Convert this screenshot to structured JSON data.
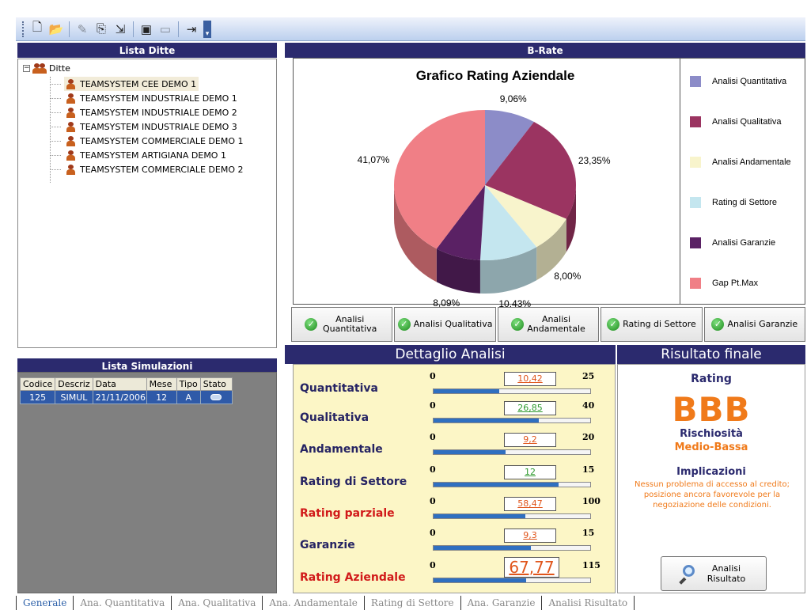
{
  "toolbar": {
    "buttons": [
      "new-icon",
      "open-icon",
      "edit-icon",
      "copy-icon",
      "import-icon",
      "monitor-icon",
      "card-icon",
      "exit-icon"
    ]
  },
  "left": {
    "companies_title": "Lista Ditte",
    "tree_root": "Ditte",
    "companies": [
      "TEAMSYSTEM CEE DEMO 1",
      "TEAMSYSTEM INDUSTRIALE DEMO 1",
      "TEAMSYSTEM INDUSTRIALE DEMO 2",
      "TEAMSYSTEM INDUSTRIALE DEMO 3",
      "TEAMSYSTEM COMMERCIALE DEMO 1",
      "TEAMSYSTEM ARTIGIANA DEMO 1",
      "TEAMSYSTEM COMMERCIALE DEMO 2"
    ],
    "selected_index": 0,
    "sims_title": "Lista Simulazioni",
    "sims_columns": [
      "Codice",
      "Descriz",
      "Data",
      "Mese",
      "Tipo",
      "Stato"
    ],
    "sims_rows": [
      [
        "125",
        "SIMUL",
        "21/11/2006",
        "12",
        "A",
        ""
      ]
    ]
  },
  "chart_panel": {
    "title": "B-Rate"
  },
  "chart_data": {
    "type": "pie",
    "title": "Grafico Rating Aziendale",
    "slices": [
      {
        "name": "Analisi Quantitativa",
        "value": 9.06,
        "label": "9,06%",
        "color": "#8c8cc8"
      },
      {
        "name": "Analisi Qualitativa",
        "value": 23.35,
        "label": "23,35%",
        "color": "#9b3461"
      },
      {
        "name": "Analisi Andamentale",
        "value": 8.0,
        "label": "8,00%",
        "color": "#f8f4cc"
      },
      {
        "name": "Rating di Settore",
        "value": 10.43,
        "label": "10,43%",
        "color": "#c4e6ef"
      },
      {
        "name": "Analisi Garanzie",
        "value": 8.09,
        "label": "8,09%",
        "color": "#5a2164"
      },
      {
        "name": "Gap Pt.Max",
        "value": 41.07,
        "label": "41,07%",
        "color": "#f07f86"
      }
    ],
    "legend_position": "right"
  },
  "analysis_tabs": [
    "Analisi Quantitativa",
    "Analisi Qualitativa",
    "Analisi Andamentale",
    "Rating di Settore",
    "Analisi Garanzie"
  ],
  "detail": {
    "title": "Dettaglio Analisi",
    "rows": [
      {
        "label": "Quantitativa",
        "min": "0",
        "max": "25",
        "value": "10,42",
        "fraction": 0.417,
        "value_color": "#e0551b",
        "label_color": "blue"
      },
      {
        "label": "Qualitativa",
        "min": "0",
        "max": "40",
        "value": "26,85",
        "fraction": 0.671,
        "value_color": "#2e9a2e",
        "label_color": "blue"
      },
      {
        "label": "Andamentale",
        "min": "0",
        "max": "20",
        "value": "9,2",
        "fraction": 0.46,
        "value_color": "#e0551b",
        "label_color": "blue"
      },
      {
        "label": "Rating di Settore",
        "min": "0",
        "max": "15",
        "value": "12",
        "fraction": 0.8,
        "value_color": "#2e9a2e",
        "label_color": "blue"
      },
      {
        "label": "Rating parziale",
        "min": "0",
        "max": "100",
        "value": "58,47",
        "fraction": 0.585,
        "value_color": "#e0551b",
        "label_color": "red"
      },
      {
        "label": "Garanzie",
        "min": "0",
        "max": "15",
        "value": "9,3",
        "fraction": 0.62,
        "value_color": "#e0551b",
        "label_color": "blue"
      },
      {
        "label": "Rating Aziendale",
        "min": "0",
        "max": "115",
        "value": "67,77",
        "fraction": 0.589,
        "value_color": "#e0551b",
        "label_color": "red"
      }
    ]
  },
  "result": {
    "title": "Risultato finale",
    "rating_label": "Rating",
    "rating_value": "BBB",
    "risk_label": "Rischiosità",
    "risk_value": "Medio-Bassa",
    "impl_label": "Implicazioni",
    "impl_text": "Nessun problema di accesso al credito; posizione ancora favorevole per la negoziazione delle condizioni.",
    "button_label": "Analisi Risultato"
  },
  "bottom_tabs": [
    "Generale",
    "Ana. Quantitativa",
    "Ana. Qualitativa",
    "Ana. Andamentale",
    "Rating di Settore",
    "Ana. Garanzie",
    "Analisi Risultato"
  ],
  "active_bottom_tab": 0
}
